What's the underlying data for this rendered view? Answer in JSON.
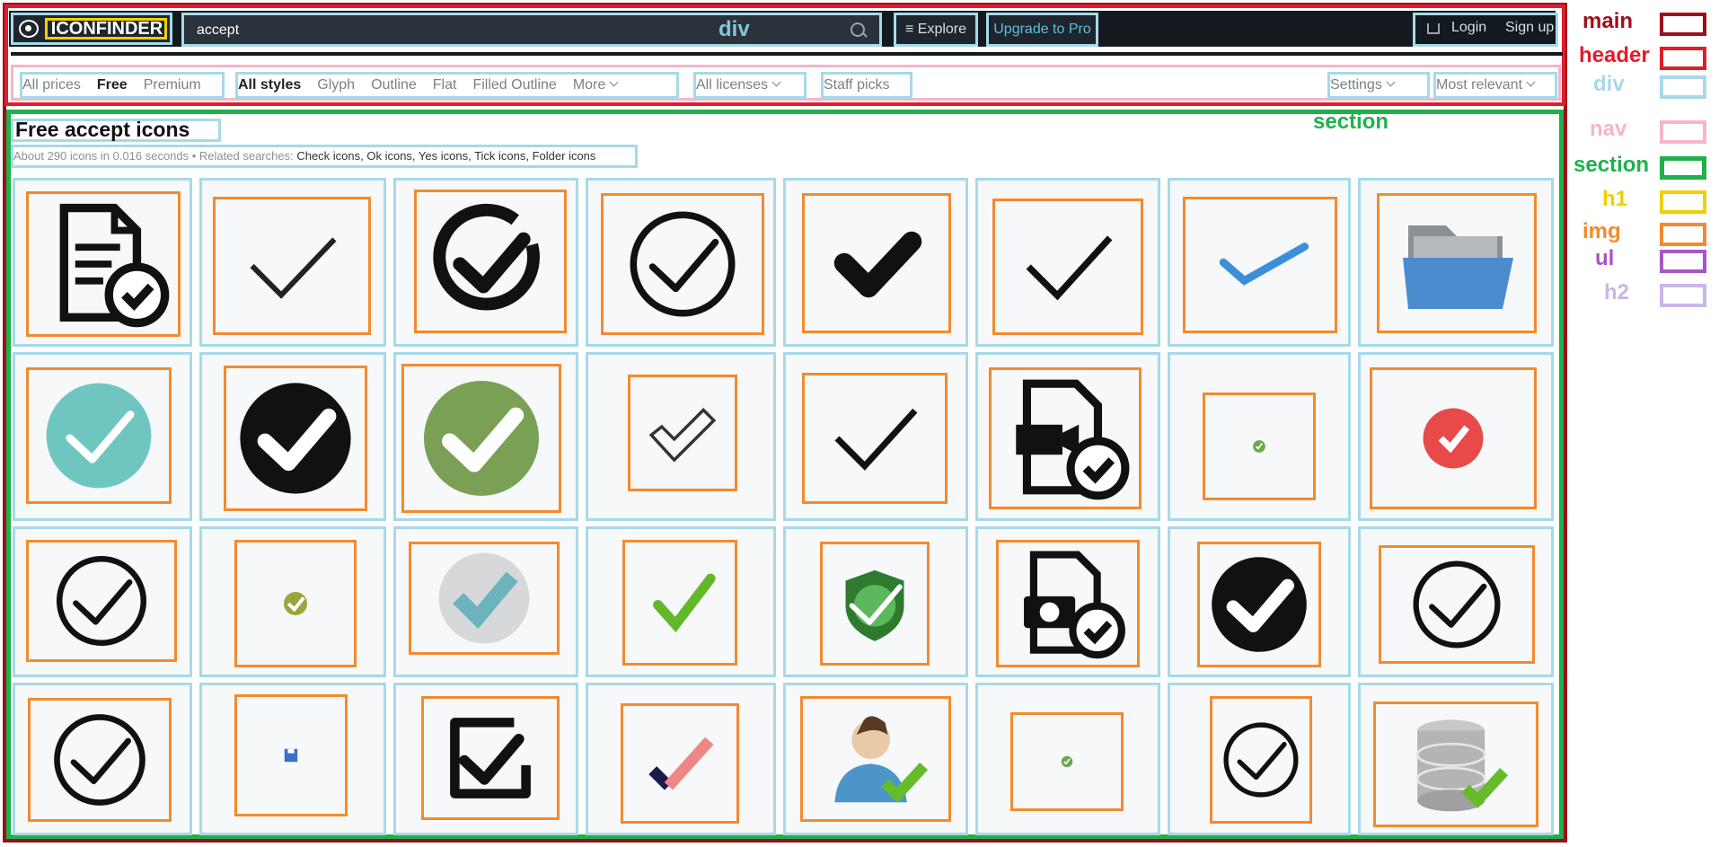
{
  "header": {
    "logo_text": "ICONFINDER",
    "search": {
      "value": "accept"
    },
    "div_tag": "div",
    "explore_label": "Explore",
    "upgrade_label": "Upgrade to Pro",
    "login_label": "Login",
    "signup_label": "Sign up"
  },
  "filters": {
    "prices": [
      "All prices",
      "Free",
      "Premium"
    ],
    "styles": [
      "All styles",
      "Glyph",
      "Outline",
      "Flat",
      "Filled Outline",
      "More"
    ],
    "licenses": "All licenses",
    "staff_picks": "Staff picks",
    "settings": "Settings",
    "sort": "Most relevant"
  },
  "results": {
    "title": "Free accept icons",
    "meta_prefix": "About 290 icons in 0.016 seconds • Related searches:",
    "related": "Check icons, Ok icons, Yes icons, Tick icons, Folder icons",
    "section_tag": "section"
  },
  "icons": [
    "document-check-icon",
    "thin-check-icon",
    "circle-arrow-check-icon",
    "circle-check-icon",
    "bold-check-icon",
    "check-icon",
    "blue-check-icon",
    "folder-icon",
    "teal-circle-check-icon",
    "black-circle-check-icon",
    "green-circle-check-icon",
    "outline-check-icon",
    "check-icon",
    "video-file-check-icon",
    "small-green-check-icon",
    "red-circle-check-icon",
    "circle-check-icon",
    "small-olive-check-icon",
    "grey-circle-teal-check-icon",
    "green-check-icon",
    "shield-check-icon",
    "camera-file-check-icon",
    "black-circle-check-icon",
    "circle-check-icon",
    "circle-check-icon",
    "floppy-icon",
    "square-check-icon",
    "pink-check-icon",
    "user-check-icon",
    "small-green-check-icon",
    "circle-check-icon",
    "database-check-icon"
  ],
  "legend": [
    {
      "label": "main",
      "color": "#9e0f1b"
    },
    {
      "label": "header",
      "color": "#e11d2b"
    },
    {
      "label": "div",
      "color": "#a7d9e8"
    },
    {
      "label": "nav",
      "color": "#f6b5cc"
    },
    {
      "label": "section",
      "color": "#1fb14a"
    },
    {
      "label": "h1",
      "color": "#f1d000"
    },
    {
      "label": "img",
      "color": "#f38a2e"
    },
    {
      "label": "ul",
      "color": "#a855c7"
    },
    {
      "label": "h2",
      "color": "#c7b8e8"
    }
  ]
}
